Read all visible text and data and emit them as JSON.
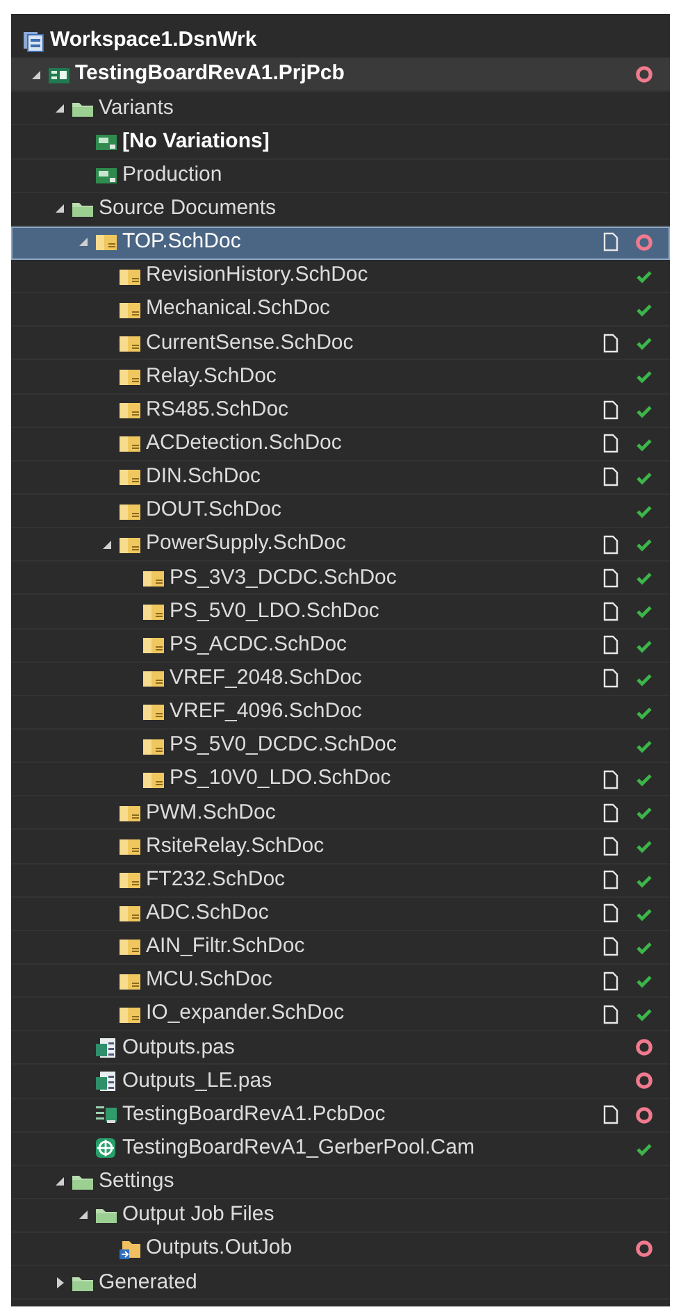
{
  "tree": {
    "label": "Workspace1.DsnWrk",
    "kind": "workspace",
    "bold": true,
    "selected": false,
    "children": [
      {
        "label": "TestingBoardRevA1.PrjPcb",
        "kind": "project",
        "bold": true,
        "selected": false,
        "expanded": true,
        "ok": false,
        "error": true,
        "children": [
          {
            "label": "Variants",
            "kind": "folder",
            "bold": false,
            "selected": false,
            "expanded": true,
            "children": [
              {
                "label": "[No Variations]",
                "kind": "variant",
                "bold": true,
                "selected": false
              },
              {
                "label": "Production",
                "kind": "variant",
                "bold": false,
                "selected": false
              }
            ]
          },
          {
            "label": "Source Documents",
            "kind": "folder",
            "bold": false,
            "selected": false,
            "expanded": true,
            "children": [
              {
                "label": "TOP.SchDoc",
                "kind": "schematic",
                "bold": false,
                "selected": true,
                "expanded": true,
                "modified": true,
                "ok": false,
                "error": true,
                "children": [
                  {
                    "label": "RevisionHistory.SchDoc",
                    "kind": "schematic",
                    "bold": false,
                    "selected": false,
                    "modified": false,
                    "ok": true,
                    "error": false
                  },
                  {
                    "label": "Mechanical.SchDoc",
                    "kind": "schematic",
                    "bold": false,
                    "selected": false,
                    "modified": false,
                    "ok": true,
                    "error": false
                  },
                  {
                    "label": "CurrentSense.SchDoc",
                    "kind": "schematic",
                    "bold": false,
                    "selected": false,
                    "modified": true,
                    "ok": true,
                    "error": false
                  },
                  {
                    "label": "Relay.SchDoc",
                    "kind": "schematic",
                    "bold": false,
                    "selected": false,
                    "modified": false,
                    "ok": true,
                    "error": false
                  },
                  {
                    "label": "RS485.SchDoc",
                    "kind": "schematic",
                    "bold": false,
                    "selected": false,
                    "modified": true,
                    "ok": true,
                    "error": false
                  },
                  {
                    "label": "ACDetection.SchDoc",
                    "kind": "schematic",
                    "bold": false,
                    "selected": false,
                    "modified": true,
                    "ok": true,
                    "error": false
                  },
                  {
                    "label": "DIN.SchDoc",
                    "kind": "schematic",
                    "bold": false,
                    "selected": false,
                    "modified": true,
                    "ok": true,
                    "error": false
                  },
                  {
                    "label": "DOUT.SchDoc",
                    "kind": "schematic",
                    "bold": false,
                    "selected": false,
                    "modified": false,
                    "ok": true,
                    "error": false
                  },
                  {
                    "label": "PowerSupply.SchDoc",
                    "kind": "schematic",
                    "bold": false,
                    "selected": false,
                    "expanded": true,
                    "modified": true,
                    "ok": true,
                    "error": false,
                    "children": [
                      {
                        "label": "PS_3V3_DCDC.SchDoc",
                        "kind": "schematic",
                        "bold": false,
                        "selected": false,
                        "modified": true,
                        "ok": true,
                        "error": false
                      },
                      {
                        "label": "PS_5V0_LDO.SchDoc",
                        "kind": "schematic",
                        "bold": false,
                        "selected": false,
                        "modified": true,
                        "ok": true,
                        "error": false
                      },
                      {
                        "label": "PS_ACDC.SchDoc",
                        "kind": "schematic",
                        "bold": false,
                        "selected": false,
                        "modified": true,
                        "ok": true,
                        "error": false
                      },
                      {
                        "label": "VREF_2048.SchDoc",
                        "kind": "schematic",
                        "bold": false,
                        "selected": false,
                        "modified": true,
                        "ok": true,
                        "error": false
                      },
                      {
                        "label": "VREF_4096.SchDoc",
                        "kind": "schematic",
                        "bold": false,
                        "selected": false,
                        "modified": false,
                        "ok": true,
                        "error": false
                      },
                      {
                        "label": "PS_5V0_DCDC.SchDoc",
                        "kind": "schematic",
                        "bold": false,
                        "selected": false,
                        "modified": false,
                        "ok": true,
                        "error": false
                      },
                      {
                        "label": "PS_10V0_LDO.SchDoc",
                        "kind": "schematic",
                        "bold": false,
                        "selected": false,
                        "modified": true,
                        "ok": true,
                        "error": false
                      }
                    ]
                  },
                  {
                    "label": "PWM.SchDoc",
                    "kind": "schematic",
                    "bold": false,
                    "selected": false,
                    "modified": true,
                    "ok": true,
                    "error": false
                  },
                  {
                    "label": "RsiteRelay.SchDoc",
                    "kind": "schematic",
                    "bold": false,
                    "selected": false,
                    "modified": true,
                    "ok": true,
                    "error": false
                  },
                  {
                    "label": "FT232.SchDoc",
                    "kind": "schematic",
                    "bold": false,
                    "selected": false,
                    "modified": true,
                    "ok": true,
                    "error": false
                  },
                  {
                    "label": "ADC.SchDoc",
                    "kind": "schematic",
                    "bold": false,
                    "selected": false,
                    "modified": true,
                    "ok": true,
                    "error": false
                  },
                  {
                    "label": "AIN_Filtr.SchDoc",
                    "kind": "schematic",
                    "bold": false,
                    "selected": false,
                    "modified": true,
                    "ok": true,
                    "error": false
                  },
                  {
                    "label": "MCU.SchDoc",
                    "kind": "schematic",
                    "bold": false,
                    "selected": false,
                    "modified": true,
                    "ok": true,
                    "error": false
                  },
                  {
                    "label": "IO_expander.SchDoc",
                    "kind": "schematic",
                    "bold": false,
                    "selected": false,
                    "modified": true,
                    "ok": true,
                    "error": false
                  }
                ]
              },
              {
                "label": "Outputs.pas",
                "kind": "script",
                "bold": false,
                "selected": false,
                "modified": false,
                "ok": false,
                "error": true
              },
              {
                "label": "Outputs_LE.pas",
                "kind": "script",
                "bold": false,
                "selected": false,
                "modified": false,
                "ok": false,
                "error": true
              },
              {
                "label": "TestingBoardRevA1.PcbDoc",
                "kind": "pcb",
                "bold": false,
                "selected": false,
                "modified": true,
                "ok": false,
                "error": true
              },
              {
                "label": "TestingBoardRevA1_GerberPool.Cam",
                "kind": "cam",
                "bold": false,
                "selected": false,
                "modified": false,
                "ok": true,
                "error": false
              }
            ]
          },
          {
            "label": "Settings",
            "kind": "folder",
            "bold": false,
            "selected": false,
            "expanded": true,
            "children": [
              {
                "label": "Output Job Files",
                "kind": "folder",
                "bold": false,
                "selected": false,
                "expanded": true,
                "children": [
                  {
                    "label": "Outputs.OutJob",
                    "kind": "outjob",
                    "bold": false,
                    "selected": false,
                    "ok": false,
                    "error": true
                  }
                ]
              }
            ]
          },
          {
            "label": "Generated",
            "kind": "folder",
            "bold": false,
            "selected": false,
            "expanded": false
          }
        ]
      }
    ]
  }
}
